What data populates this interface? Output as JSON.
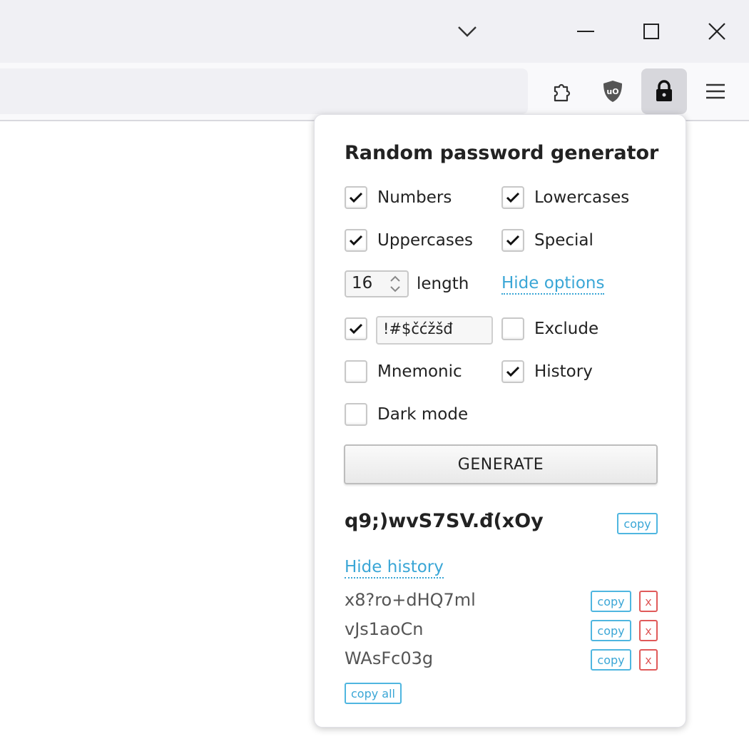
{
  "chrome": {
    "icons": [
      "tab-list-chevron-icon",
      "minimize-icon",
      "maximize-icon",
      "close-icon",
      "extensions-puzzle-icon",
      "ublock-shield-icon",
      "lock-icon",
      "hamburger-menu-icon"
    ]
  },
  "popup": {
    "title": "Random password generator",
    "options": {
      "numbers": {
        "label": "Numbers",
        "checked": true
      },
      "lowercases": {
        "label": "Lowercases",
        "checked": true
      },
      "uppercases": {
        "label": "Uppercases",
        "checked": true
      },
      "special": {
        "label": "Special",
        "checked": true
      },
      "length_value": "16",
      "length_label": "length",
      "hide_options": "Hide options",
      "custom_chars": {
        "value": "!#$čćžšđ",
        "checked": true
      },
      "exclude": {
        "label": "Exclude",
        "checked": false
      },
      "mnemonic": {
        "label": "Mnemonic",
        "checked": false
      },
      "history": {
        "label": "History",
        "checked": true
      },
      "dark_mode": {
        "label": "Dark mode",
        "checked": false
      }
    },
    "generate_label": "GENERATE",
    "password": "q9;)wvS7SV.đ(xOy",
    "copy_label": "copy",
    "hide_history": "Hide history",
    "history_items": [
      {
        "value": "x8?ro+dHQ7ml",
        "copy": "copy",
        "delete": "x"
      },
      {
        "value": "vJs1aoCn",
        "copy": "copy",
        "delete": "x"
      },
      {
        "value": "WAsFc03g",
        "copy": "copy",
        "delete": "x"
      }
    ],
    "copy_all_label": "copy all"
  },
  "colors": {
    "link": "#3aa6d6",
    "delete": "#e05a5a",
    "titlebar": "#f0f0f4",
    "toolbar": "#f9f9fb"
  }
}
